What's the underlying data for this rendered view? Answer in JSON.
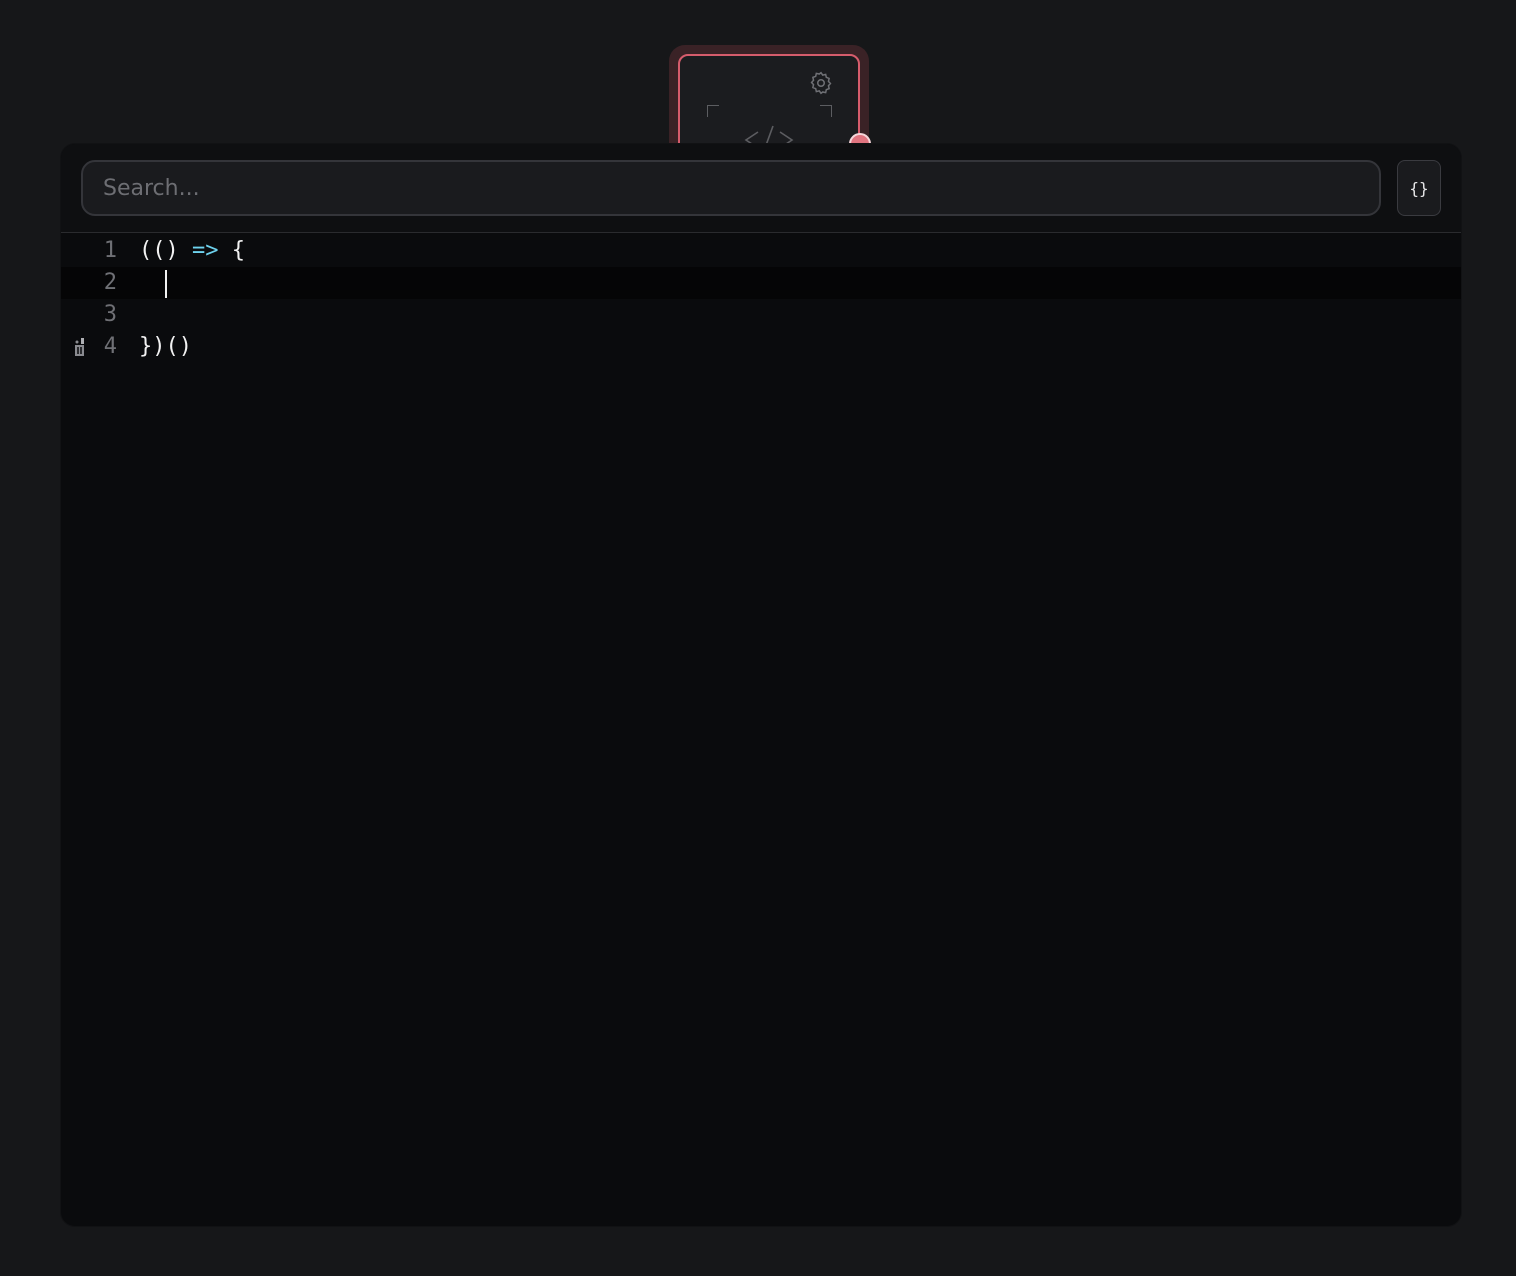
{
  "node": {
    "settings_icon": "gear-icon",
    "code_icon": "code-brackets-icon",
    "accent_color": "#d65c6c",
    "port_color": "#e07480"
  },
  "search": {
    "placeholder": "Search...",
    "value": ""
  },
  "toolbar": {
    "format_label": "{}"
  },
  "editor": {
    "lines": [
      {
        "number": "1",
        "paren": "(()",
        "arrow": "=>",
        "brace": "{"
      },
      {
        "number": "2",
        "text": "  "
      },
      {
        "number": "3",
        "text": ""
      },
      {
        "number": "4",
        "text": "})()"
      }
    ],
    "active_line": 2,
    "colors": {
      "text": "#f2f2f2",
      "arrow": "#6ed3ee",
      "line_number": "#6f7075"
    },
    "gutter_icon": "lint-marker-icon"
  }
}
